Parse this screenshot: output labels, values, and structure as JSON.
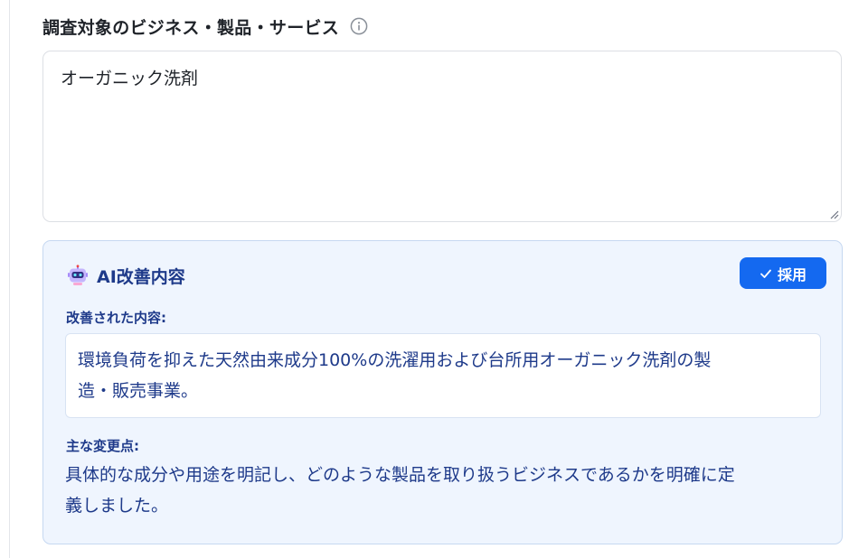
{
  "field": {
    "label": "調査対象のビジネス・製品・サービス",
    "info_icon": "info-circle-icon",
    "value": "オーガニック洗剤"
  },
  "ai_panel": {
    "icon": "robot-icon",
    "title": "AI改善内容",
    "adopt_button": {
      "icon": "check-icon",
      "label": "採用"
    },
    "improved_label": "改善された内容:",
    "improved_lines": [
      "環境負荷を抑えた天然由来成分100%の洗濯用および台所用オーガニック洗剤の製",
      "造・販売事業。"
    ],
    "changes_label": "主な変更点:",
    "changes_lines": [
      "具体的な成分や用途を明記し、どのような製品を取り扱うビジネスであるかを明確に定",
      "義しました。"
    ]
  },
  "colors": {
    "accent": "#1469f0",
    "panel_bg": "#eff5fe",
    "panel_text": "#1e3a8a"
  }
}
